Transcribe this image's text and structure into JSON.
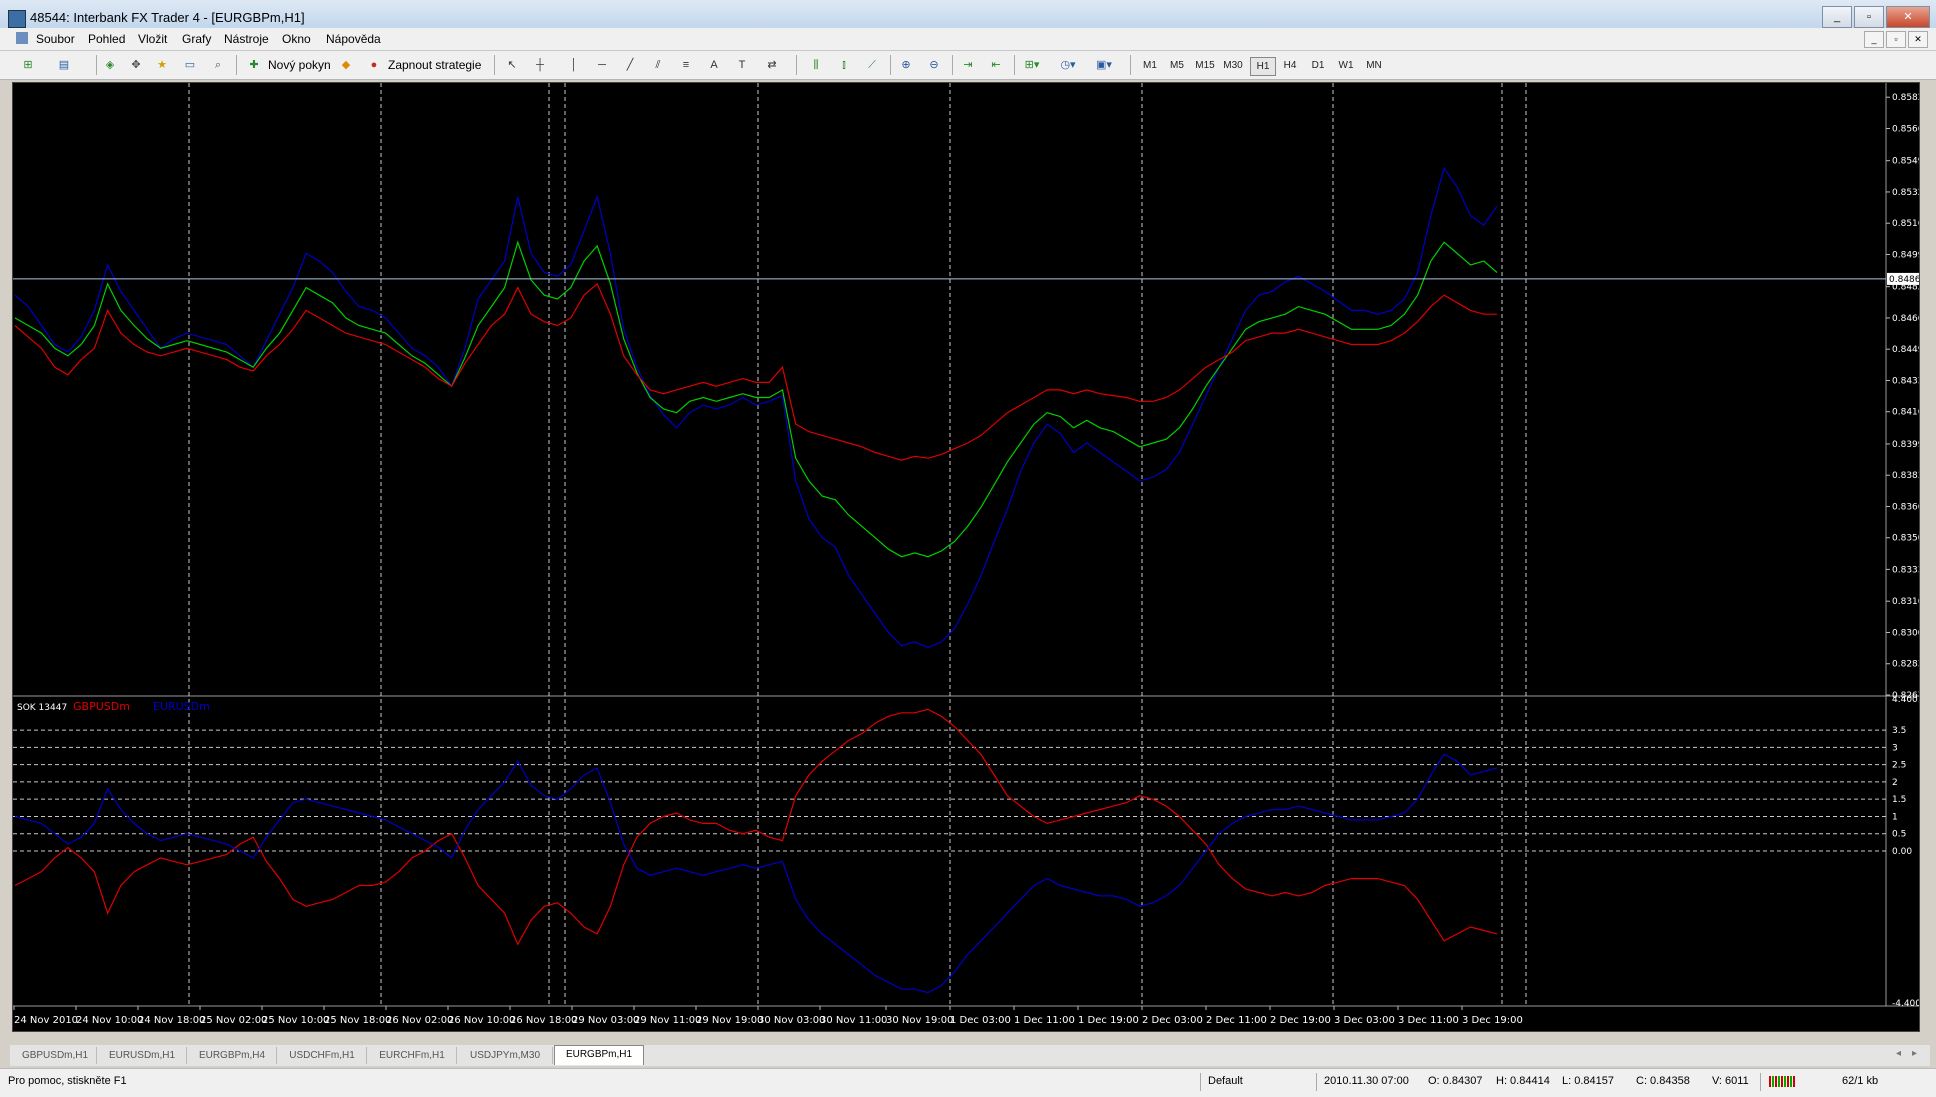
{
  "window": {
    "title": "48544: Interbank FX Trader 4 - [EURGBPm,H1]",
    "buttons": [
      "_",
      "▫",
      "✕"
    ]
  },
  "menu": {
    "items": [
      "Soubor",
      "Pohled",
      "Vložit",
      "Grafy",
      "Nástroje",
      "Okno",
      "Nápověda"
    ]
  },
  "toolbar": {
    "new_order": "Nový pokyn",
    "strategies": "Zapnout strategie",
    "timeframes": [
      "M1",
      "M5",
      "M15",
      "M30",
      "H1",
      "H4",
      "D1",
      "W1",
      "MN"
    ],
    "active_timeframe": "H1"
  },
  "chart_data": {
    "type": "line",
    "symbol": "EURGBPm",
    "timeframe": "H1",
    "main": {
      "price_ticks": [
        "0.85825",
        "0.85660",
        "0.85490",
        "0.85325",
        "0.85160",
        "0.84995",
        "0.84825",
        "0.84660",
        "0.84495",
        "0.84330",
        "0.84165",
        "0.83995",
        "0.83830",
        "0.83665",
        "0.83500",
        "0.83333",
        "0.83165",
        "0.83000",
        "0.82835",
        "0.82670"
      ],
      "ylim": [
        0.8267,
        0.859
      ],
      "current_price": "0.84866",
      "current_price_value": 0.84866,
      "series": [
        {
          "color": "#0000c8",
          "values": [
            0.8478,
            0.8472,
            0.8462,
            0.8452,
            0.8448,
            0.8456,
            0.847,
            0.8494,
            0.848,
            0.847,
            0.846,
            0.845,
            0.8455,
            0.8458,
            0.8456,
            0.8454,
            0.8452,
            0.8446,
            0.844,
            0.8454,
            0.8468,
            0.8482,
            0.85,
            0.8496,
            0.849,
            0.848,
            0.8472,
            0.847,
            0.8466,
            0.8458,
            0.845,
            0.8446,
            0.844,
            0.843,
            0.845,
            0.8476,
            0.8486,
            0.8496,
            0.853,
            0.85,
            0.849,
            0.8488,
            0.8494,
            0.8512,
            0.853,
            0.85,
            0.846,
            0.844,
            0.8425,
            0.8415,
            0.8408,
            0.8416,
            0.842,
            0.8418,
            0.842,
            0.8424,
            0.842,
            0.8422,
            0.8425,
            0.838,
            0.836,
            0.835,
            0.8345,
            0.833,
            0.832,
            0.831,
            0.83,
            0.8293,
            0.8295,
            0.8292,
            0.8295,
            0.8302,
            0.8315,
            0.833,
            0.8348,
            0.8365,
            0.8385,
            0.84,
            0.841,
            0.8405,
            0.8395,
            0.84,
            0.8395,
            0.839,
            0.8385,
            0.838,
            0.8382,
            0.8386,
            0.8395,
            0.841,
            0.8425,
            0.844,
            0.8455,
            0.847,
            0.8478,
            0.848,
            0.8485,
            0.8488,
            0.8484,
            0.848,
            0.8475,
            0.847,
            0.847,
            0.8468,
            0.847,
            0.8476,
            0.849,
            0.852,
            0.8545,
            0.8535,
            0.852,
            0.8515,
            0.8525
          ]
        },
        {
          "color": "#00d000",
          "values": [
            0.8466,
            0.8462,
            0.8458,
            0.845,
            0.8446,
            0.8452,
            0.8462,
            0.8484,
            0.847,
            0.8462,
            0.8455,
            0.845,
            0.8452,
            0.8454,
            0.8452,
            0.845,
            0.8448,
            0.8444,
            0.844,
            0.845,
            0.8458,
            0.847,
            0.8482,
            0.8478,
            0.8474,
            0.8466,
            0.8462,
            0.846,
            0.8458,
            0.8452,
            0.8446,
            0.8442,
            0.8436,
            0.843,
            0.8445,
            0.8462,
            0.8472,
            0.8482,
            0.8506,
            0.8486,
            0.8478,
            0.8476,
            0.8482,
            0.8496,
            0.8504,
            0.8484,
            0.8455,
            0.8437,
            0.8424,
            0.8418,
            0.8416,
            0.8422,
            0.8424,
            0.8422,
            0.8424,
            0.8426,
            0.8424,
            0.8424,
            0.8428,
            0.8392,
            0.838,
            0.8372,
            0.837,
            0.8362,
            0.8356,
            0.835,
            0.8344,
            0.834,
            0.8342,
            0.834,
            0.8343,
            0.8348,
            0.8356,
            0.8366,
            0.8378,
            0.839,
            0.84,
            0.841,
            0.8416,
            0.8414,
            0.8408,
            0.8412,
            0.8408,
            0.8406,
            0.8402,
            0.8398,
            0.84,
            0.8402,
            0.8408,
            0.8418,
            0.843,
            0.844,
            0.845,
            0.846,
            0.8464,
            0.8466,
            0.8468,
            0.8472,
            0.847,
            0.8468,
            0.8464,
            0.846,
            0.846,
            0.846,
            0.8462,
            0.8468,
            0.8478,
            0.8496,
            0.8506,
            0.85,
            0.8494,
            0.8496,
            0.849
          ]
        },
        {
          "color": "#e00000",
          "values": [
            0.8462,
            0.8456,
            0.845,
            0.844,
            0.8436,
            0.8444,
            0.845,
            0.847,
            0.8458,
            0.8452,
            0.8448,
            0.8446,
            0.8448,
            0.845,
            0.8448,
            0.8446,
            0.8444,
            0.844,
            0.8438,
            0.8446,
            0.8452,
            0.846,
            0.847,
            0.8466,
            0.8462,
            0.8458,
            0.8456,
            0.8454,
            0.8452,
            0.8448,
            0.8444,
            0.844,
            0.8434,
            0.843,
            0.8442,
            0.8452,
            0.8462,
            0.8468,
            0.8482,
            0.8468,
            0.8464,
            0.8462,
            0.8466,
            0.8478,
            0.8484,
            0.8468,
            0.8446,
            0.8436,
            0.8428,
            0.8426,
            0.8428,
            0.843,
            0.8432,
            0.843,
            0.8432,
            0.8434,
            0.8432,
            0.8432,
            0.844,
            0.841,
            0.8406,
            0.8404,
            0.8402,
            0.84,
            0.8398,
            0.8395,
            0.8393,
            0.8391,
            0.8393,
            0.8392,
            0.8394,
            0.8397,
            0.84,
            0.8404,
            0.841,
            0.8416,
            0.842,
            0.8424,
            0.8428,
            0.8428,
            0.8426,
            0.8428,
            0.8426,
            0.8425,
            0.8424,
            0.8422,
            0.8422,
            0.8424,
            0.8428,
            0.8434,
            0.844,
            0.8444,
            0.8448,
            0.8454,
            0.8456,
            0.8458,
            0.8458,
            0.846,
            0.8458,
            0.8456,
            0.8454,
            0.8452,
            0.8452,
            0.8452,
            0.8454,
            0.8458,
            0.8464,
            0.8472,
            0.8478,
            0.8474,
            0.847,
            0.8468,
            0.8468
          ]
        }
      ]
    },
    "indicator": {
      "name": "SOK 13447",
      "legend": [
        {
          "name": "GBPUSDm",
          "color": "#e00000"
        },
        {
          "name": "EURUSDm",
          "color": "#0000c8"
        }
      ],
      "ticks": [
        "4.4001",
        "3.5",
        "3",
        "2.5",
        "2",
        "1.5",
        "1",
        "0.5",
        "0.00",
        "-4.4001"
      ],
      "levels": [
        3.5,
        3,
        2.5,
        2,
        1.5,
        1,
        0.5,
        0
      ],
      "ylim": [
        -4.4001,
        4.4001
      ],
      "series": [
        {
          "name": "GBPUSDm",
          "color": "#e00000",
          "values": [
            -1.0,
            -0.8,
            -0.6,
            -0.2,
            0.1,
            -0.2,
            -0.6,
            -1.8,
            -1.0,
            -0.6,
            -0.4,
            -0.2,
            -0.3,
            -0.4,
            -0.3,
            -0.2,
            -0.1,
            0.2,
            0.4,
            -0.3,
            -0.8,
            -1.4,
            -1.6,
            -1.5,
            -1.4,
            -1.2,
            -1.0,
            -1.0,
            -0.9,
            -0.6,
            -0.2,
            0.0,
            0.3,
            0.5,
            -0.2,
            -1.0,
            -1.4,
            -1.8,
            -2.7,
            -2.0,
            -1.6,
            -1.5,
            -1.8,
            -2.2,
            -2.4,
            -1.6,
            -0.4,
            0.4,
            0.8,
            1.0,
            1.1,
            0.9,
            0.8,
            0.8,
            0.6,
            0.5,
            0.6,
            0.4,
            0.3,
            1.6,
            2.2,
            2.6,
            2.9,
            3.2,
            3.4,
            3.7,
            3.9,
            4.0,
            4.0,
            4.1,
            3.9,
            3.6,
            3.2,
            2.8,
            2.2,
            1.6,
            1.3,
            1.0,
            0.8,
            0.9,
            1.0,
            1.1,
            1.2,
            1.3,
            1.4,
            1.6,
            1.5,
            1.3,
            1.0,
            0.6,
            0.2,
            -0.4,
            -0.8,
            -1.1,
            -1.2,
            -1.3,
            -1.2,
            -1.3,
            -1.2,
            -1.0,
            -0.9,
            -0.8,
            -0.8,
            -0.8,
            -0.9,
            -1.0,
            -1.4,
            -2.0,
            -2.6,
            -2.4,
            -2.2,
            -2.3,
            -2.4
          ]
        },
        {
          "name": "EURUSDm",
          "color": "#0000c8",
          "values": [
            1.0,
            0.9,
            0.8,
            0.5,
            0.2,
            0.4,
            0.8,
            1.8,
            1.2,
            0.8,
            0.5,
            0.3,
            0.4,
            0.5,
            0.4,
            0.3,
            0.2,
            0.0,
            -0.2,
            0.4,
            0.9,
            1.4,
            1.5,
            1.4,
            1.3,
            1.2,
            1.1,
            1.0,
            0.9,
            0.7,
            0.5,
            0.3,
            0.1,
            -0.2,
            0.6,
            1.2,
            1.6,
            2.0,
            2.6,
            1.9,
            1.6,
            1.5,
            1.8,
            2.2,
            2.4,
            1.4,
            0.2,
            -0.5,
            -0.7,
            -0.6,
            -0.5,
            -0.6,
            -0.7,
            -0.6,
            -0.5,
            -0.4,
            -0.5,
            -0.4,
            -0.3,
            -1.4,
            -2.0,
            -2.4,
            -2.7,
            -3.0,
            -3.3,
            -3.6,
            -3.8,
            -4.0,
            -4.0,
            -4.1,
            -3.9,
            -3.5,
            -3.0,
            -2.6,
            -2.2,
            -1.8,
            -1.4,
            -1.0,
            -0.8,
            -1.0,
            -1.1,
            -1.2,
            -1.3,
            -1.3,
            -1.4,
            -1.6,
            -1.5,
            -1.3,
            -1.0,
            -0.5,
            0.0,
            0.5,
            0.8,
            1.0,
            1.1,
            1.2,
            1.2,
            1.3,
            1.2,
            1.1,
            1.0,
            0.9,
            0.9,
            0.9,
            1.0,
            1.1,
            1.5,
            2.2,
            2.8,
            2.6,
            2.2,
            2.3,
            2.4
          ]
        }
      ]
    },
    "x_ticks": [
      "24 Nov 2010",
      "24 Nov 10:00",
      "24 Nov 18:00",
      "25 Nov 02:00",
      "25 Nov 10:00",
      "25 Nov 18:00",
      "26 Nov 02:00",
      "26 Nov 10:00",
      "26 Nov 18:00",
      "29 Nov 03:00",
      "29 Nov 11:00",
      "29 Nov 19:00",
      "30 Nov 03:00",
      "30 Nov 11:00",
      "30 Nov 19:00",
      "1 Dec 03:00",
      "1 Dec 11:00",
      "1 Dec 19:00",
      "2 Dec 03:00",
      "2 Dec 11:00",
      "2 Dec 19:00",
      "3 Dec 03:00",
      "3 Dec 11:00",
      "3 Dec 19:00"
    ],
    "grid": "vertical dashed at day/period separators"
  },
  "tabs": {
    "items": [
      "GBPUSDm,H1",
      "EURUSDm,H1",
      "EURGBPm,H4",
      "USDCHFm,H1",
      "EURCHFm,H1",
      "USDJPYm,M30",
      "EURGBPm,H1"
    ],
    "active": "EURGBPm,H1"
  },
  "status": {
    "help": "Pro pomoc, stiskněte F1",
    "profile": "Default",
    "datetime": "2010.11.30 07:00",
    "open": "O: 0.84307",
    "high": "H: 0.84414",
    "low": "L: 0.84157",
    "close": "C: 0.84358",
    "volume": "V: 6011",
    "traffic": "62/1 kb"
  }
}
